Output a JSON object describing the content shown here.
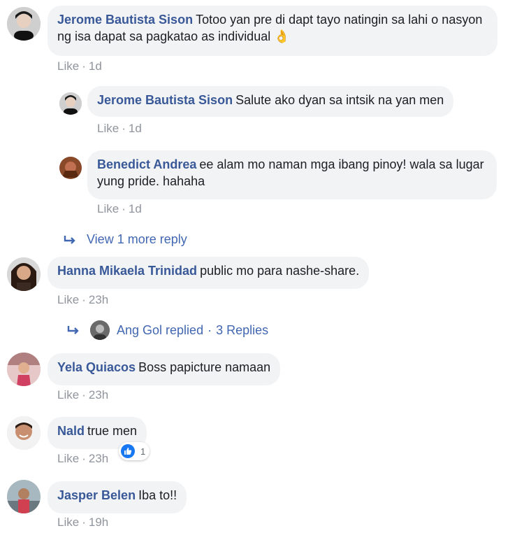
{
  "comments": [
    {
      "author": "Jerome Bautista Sison",
      "text": "Totoo yan pre di dapt tayo natingin sa lahi o nasyon ng isa dapat sa pagkatao as individual 👌",
      "like": "Like",
      "time": "1d"
    },
    {
      "author": "Jerome Bautista Sison",
      "text": "Salute ako dyan sa intsik na yan men",
      "like": "Like",
      "time": "1d"
    },
    {
      "author": "Benedict Andrea",
      "text": "ee alam mo naman mga ibang pinoy! wala sa lugar yung pride. hahaha",
      "like": "Like",
      "time": "1d"
    },
    {
      "author": "Hanna Mikaela Trinidad",
      "text": "public mo para nashe-share.",
      "like": "Like",
      "time": "23h"
    },
    {
      "author": "Yela Quiacos",
      "text": "Boss papicture namaan",
      "like": "Like",
      "time": "23h"
    },
    {
      "author": "Nald",
      "text": "true men",
      "like": "Like",
      "time": "23h",
      "reaction_count": "1"
    },
    {
      "author": "Jasper Belen",
      "text": "Iba to!!",
      "like": "Like",
      "time": "19h"
    }
  ],
  "view_more": "View 1 more reply",
  "replied": {
    "name_text": "Ang Gol replied",
    "sep": "·",
    "count_text": "3 Replies"
  },
  "separator": "·",
  "colors": {
    "author": "#385898",
    "link": "#4267b2",
    "bubble": "#f2f3f5",
    "meta": "#90949c",
    "like_blue": "#1877f2"
  }
}
